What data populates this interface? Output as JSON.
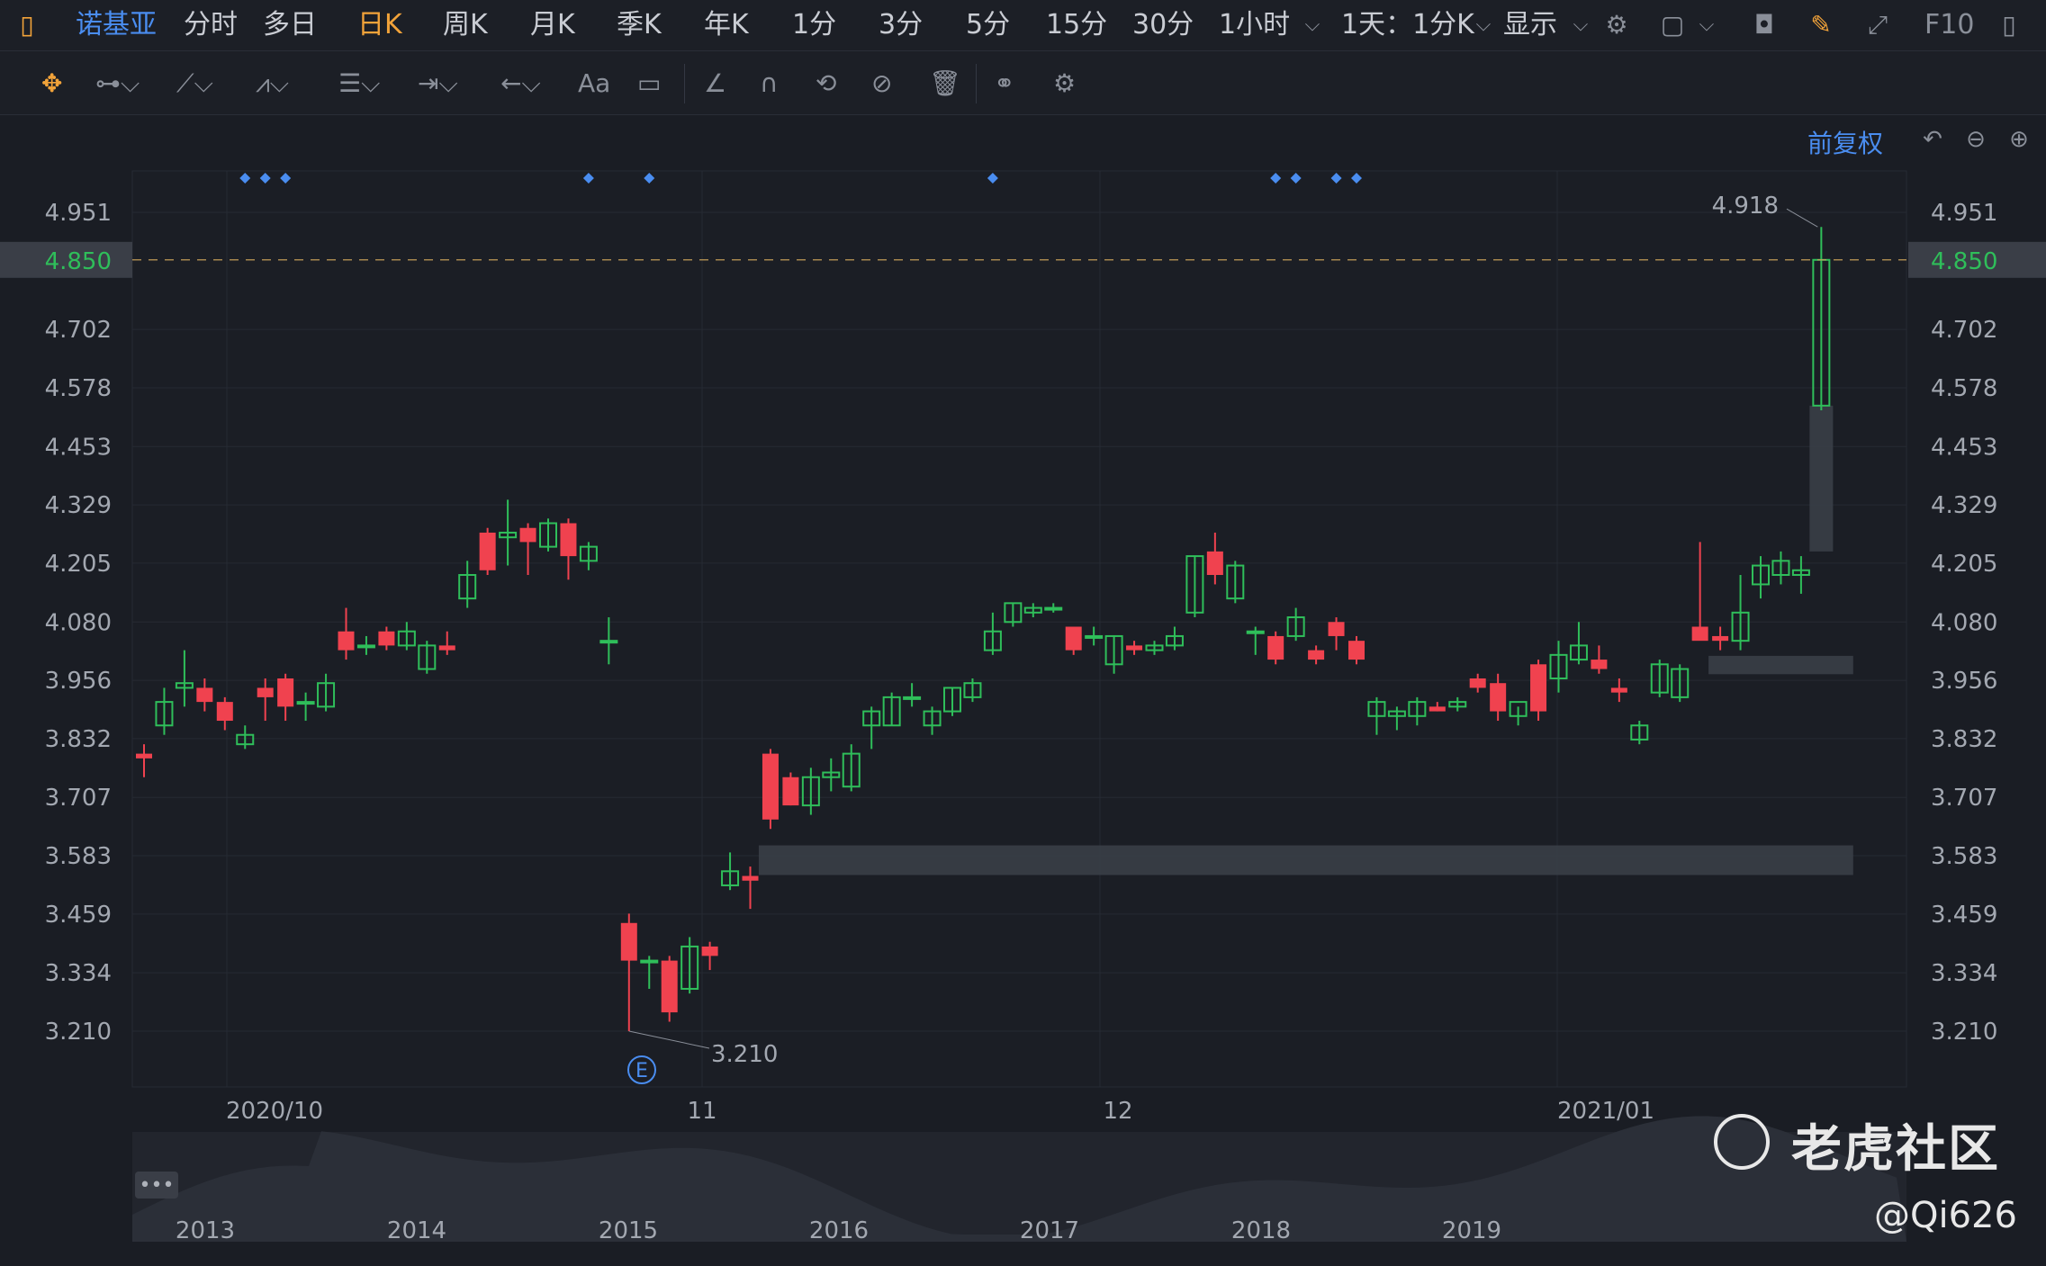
{
  "topbar": {
    "stock_name": "诺基亚",
    "periods": [
      "分时",
      "多日",
      "日K",
      "周K",
      "月K",
      "季K",
      "年K",
      "1分",
      "3分",
      "5分",
      "15分",
      "30分",
      "1小时"
    ],
    "active_period": "日K",
    "interval": "1天：1分K",
    "display_label": "显示",
    "f10_label": "F10"
  },
  "toolbar": {
    "font_label": "Aa"
  },
  "chart_header": {
    "adjust_label": "前复权"
  },
  "colors": {
    "up": "#f0424f",
    "down": "#2fbe5a",
    "current_price": "#2fbe5a",
    "marker": "#4a8df0",
    "gap_box": "#3a3e47"
  },
  "chart_data": {
    "type": "candlestick",
    "y_ticks": [
      "4.951",
      "4.702",
      "4.578",
      "4.453",
      "4.329",
      "4.205",
      "4.080",
      "3.956",
      "3.832",
      "3.707",
      "3.583",
      "3.459",
      "3.334",
      "3.210"
    ],
    "ylim": [
      3.2,
      4.955
    ],
    "current_price": "4.850",
    "high_label": "4.918",
    "low_label": "3.210",
    "event_marker": "E",
    "x_labels": [
      "2020/10",
      "11",
      "12",
      "2021/01"
    ],
    "navigator_labels": [
      "2013",
      "2014",
      "2015",
      "2016",
      "2017",
      "2018",
      "2019"
    ],
    "candles": [
      {
        "o": 3.8,
        "h": 3.82,
        "l": 3.75,
        "c": 3.79
      },
      {
        "o": 3.86,
        "h": 3.94,
        "l": 3.84,
        "c": 3.91
      },
      {
        "o": 3.94,
        "h": 4.02,
        "l": 3.9,
        "c": 3.95
      },
      {
        "o": 3.94,
        "h": 3.96,
        "l": 3.89,
        "c": 3.91
      },
      {
        "o": 3.91,
        "h": 3.92,
        "l": 3.85,
        "c": 3.87
      },
      {
        "o": 3.82,
        "h": 3.86,
        "l": 3.81,
        "c": 3.84
      },
      {
        "o": 3.94,
        "h": 3.96,
        "l": 3.87,
        "c": 3.92
      },
      {
        "o": 3.96,
        "h": 3.97,
        "l": 3.87,
        "c": 3.9
      },
      {
        "o": 3.91,
        "h": 3.93,
        "l": 3.87,
        "c": 3.91
      },
      {
        "o": 3.9,
        "h": 3.97,
        "l": 3.89,
        "c": 3.95
      },
      {
        "o": 4.06,
        "h": 4.11,
        "l": 4.0,
        "c": 4.02
      },
      {
        "o": 4.03,
        "h": 4.05,
        "l": 4.01,
        "c": 4.03
      },
      {
        "o": 4.06,
        "h": 4.07,
        "l": 4.02,
        "c": 4.03
      },
      {
        "o": 4.03,
        "h": 4.08,
        "l": 4.02,
        "c": 4.06
      },
      {
        "o": 3.98,
        "h": 4.04,
        "l": 3.97,
        "c": 4.03
      },
      {
        "o": 4.03,
        "h": 4.06,
        "l": 4.01,
        "c": 4.02
      },
      {
        "o": 4.13,
        "h": 4.21,
        "l": 4.11,
        "c": 4.18
      },
      {
        "o": 4.27,
        "h": 4.28,
        "l": 4.18,
        "c": 4.19
      },
      {
        "o": 4.26,
        "h": 4.34,
        "l": 4.2,
        "c": 4.27
      },
      {
        "o": 4.28,
        "h": 4.29,
        "l": 4.18,
        "c": 4.25
      },
      {
        "o": 4.24,
        "h": 4.3,
        "l": 4.23,
        "c": 4.29
      },
      {
        "o": 4.29,
        "h": 4.3,
        "l": 4.17,
        "c": 4.22
      },
      {
        "o": 4.21,
        "h": 4.25,
        "l": 4.19,
        "c": 4.24
      },
      {
        "o": 4.04,
        "h": 4.09,
        "l": 3.99,
        "c": 4.04
      },
      {
        "o": 3.44,
        "h": 3.46,
        "l": 3.21,
        "c": 3.36
      },
      {
        "o": 3.36,
        "h": 3.37,
        "l": 3.3,
        "c": 3.36
      },
      {
        "o": 3.36,
        "h": 3.37,
        "l": 3.23,
        "c": 3.25
      },
      {
        "o": 3.3,
        "h": 3.41,
        "l": 3.29,
        "c": 3.39
      },
      {
        "o": 3.39,
        "h": 3.4,
        "l": 3.34,
        "c": 3.37
      },
      {
        "o": 3.52,
        "h": 3.59,
        "l": 3.51,
        "c": 3.55
      },
      {
        "o": 3.54,
        "h": 3.56,
        "l": 3.47,
        "c": 3.53
      },
      {
        "o": 3.8,
        "h": 3.81,
        "l": 3.64,
        "c": 3.66
      },
      {
        "o": 3.75,
        "h": 3.76,
        "l": 3.69,
        "c": 3.69
      },
      {
        "o": 3.69,
        "h": 3.77,
        "l": 3.67,
        "c": 3.75
      },
      {
        "o": 3.75,
        "h": 3.79,
        "l": 3.72,
        "c": 3.76
      },
      {
        "o": 3.73,
        "h": 3.82,
        "l": 3.72,
        "c": 3.8
      },
      {
        "o": 3.86,
        "h": 3.9,
        "l": 3.81,
        "c": 3.89
      },
      {
        "o": 3.86,
        "h": 3.93,
        "l": 3.86,
        "c": 3.92
      },
      {
        "o": 3.92,
        "h": 3.95,
        "l": 3.9,
        "c": 3.92
      },
      {
        "o": 3.86,
        "h": 3.9,
        "l": 3.84,
        "c": 3.89
      },
      {
        "o": 3.89,
        "h": 3.94,
        "l": 3.88,
        "c": 3.94
      },
      {
        "o": 3.92,
        "h": 3.96,
        "l": 3.91,
        "c": 3.95
      },
      {
        "o": 4.02,
        "h": 4.1,
        "l": 4.01,
        "c": 4.06
      },
      {
        "o": 4.08,
        "h": 4.12,
        "l": 4.07,
        "c": 4.12
      },
      {
        "o": 4.1,
        "h": 4.12,
        "l": 4.09,
        "c": 4.11
      },
      {
        "o": 4.11,
        "h": 4.12,
        "l": 4.1,
        "c": 4.11
      },
      {
        "o": 4.07,
        "h": 4.07,
        "l": 4.01,
        "c": 4.02
      },
      {
        "o": 4.05,
        "h": 4.07,
        "l": 4.03,
        "c": 4.05
      },
      {
        "o": 3.99,
        "h": 4.05,
        "l": 3.97,
        "c": 4.05
      },
      {
        "o": 4.03,
        "h": 4.04,
        "l": 4.01,
        "c": 4.02
      },
      {
        "o": 4.02,
        "h": 4.04,
        "l": 4.01,
        "c": 4.03
      },
      {
        "o": 4.03,
        "h": 4.07,
        "l": 4.02,
        "c": 4.05
      },
      {
        "o": 4.1,
        "h": 4.22,
        "l": 4.09,
        "c": 4.22
      },
      {
        "o": 4.23,
        "h": 4.27,
        "l": 4.16,
        "c": 4.18
      },
      {
        "o": 4.13,
        "h": 4.21,
        "l": 4.12,
        "c": 4.2
      },
      {
        "o": 4.06,
        "h": 4.07,
        "l": 4.01,
        "c": 4.06
      },
      {
        "o": 4.05,
        "h": 4.06,
        "l": 3.99,
        "c": 4.0
      },
      {
        "o": 4.05,
        "h": 4.11,
        "l": 4.04,
        "c": 4.09
      },
      {
        "o": 4.02,
        "h": 4.03,
        "l": 3.99,
        "c": 4.0
      },
      {
        "o": 4.08,
        "h": 4.09,
        "l": 4.02,
        "c": 4.05
      },
      {
        "o": 4.04,
        "h": 4.05,
        "l": 3.99,
        "c": 4.0
      },
      {
        "o": 3.88,
        "h": 3.92,
        "l": 3.84,
        "c": 3.91
      },
      {
        "o": 3.88,
        "h": 3.9,
        "l": 3.85,
        "c": 3.89
      },
      {
        "o": 3.88,
        "h": 3.92,
        "l": 3.86,
        "c": 3.91
      },
      {
        "o": 3.9,
        "h": 3.91,
        "l": 3.89,
        "c": 3.89
      },
      {
        "o": 3.9,
        "h": 3.92,
        "l": 3.89,
        "c": 3.91
      },
      {
        "o": 3.96,
        "h": 3.97,
        "l": 3.93,
        "c": 3.94
      },
      {
        "o": 3.95,
        "h": 3.97,
        "l": 3.87,
        "c": 3.89
      },
      {
        "o": 3.88,
        "h": 3.9,
        "l": 3.86,
        "c": 3.91
      },
      {
        "o": 3.99,
        "h": 4.0,
        "l": 3.87,
        "c": 3.89
      },
      {
        "o": 3.96,
        "h": 4.04,
        "l": 3.93,
        "c": 4.01
      },
      {
        "o": 4.0,
        "h": 4.08,
        "l": 3.99,
        "c": 4.03
      },
      {
        "o": 4.0,
        "h": 4.03,
        "l": 3.97,
        "c": 3.98
      },
      {
        "o": 3.94,
        "h": 3.96,
        "l": 3.91,
        "c": 3.93
      },
      {
        "o": 3.83,
        "h": 3.87,
        "l": 3.82,
        "c": 3.86
      },
      {
        "o": 3.93,
        "h": 4.0,
        "l": 3.92,
        "c": 3.99
      },
      {
        "o": 3.92,
        "h": 3.99,
        "l": 3.91,
        "c": 3.98
      },
      {
        "o": 4.07,
        "h": 4.25,
        "l": 4.06,
        "c": 4.04
      },
      {
        "o": 4.05,
        "h": 4.07,
        "l": 4.02,
        "c": 4.04
      },
      {
        "o": 4.04,
        "h": 4.18,
        "l": 4.02,
        "c": 4.1
      },
      {
        "o": 4.16,
        "h": 4.22,
        "l": 4.13,
        "c": 4.2
      },
      {
        "o": 4.18,
        "h": 4.23,
        "l": 4.16,
        "c": 4.21
      },
      {
        "o": 4.18,
        "h": 4.22,
        "l": 4.14,
        "c": 4.19
      },
      {
        "o": 4.54,
        "h": 4.92,
        "l": 4.53,
        "c": 4.85
      }
    ],
    "gap_zones": [
      {
        "top": 3.605,
        "bottom": 3.542,
        "from_index": 31,
        "to_index": 84
      },
      {
        "top": 4.008,
        "bottom": 3.969,
        "from_index": 78,
        "to_index": 84
      },
      {
        "top": 4.54,
        "bottom": 4.23,
        "from_index": 83,
        "to_index": 83
      }
    ],
    "event_markers_at": [
      5,
      6,
      7,
      22,
      25,
      42,
      56,
      57,
      59,
      60
    ]
  },
  "watermark": {
    "site": "老虎社区",
    "user": "@Qi626"
  }
}
